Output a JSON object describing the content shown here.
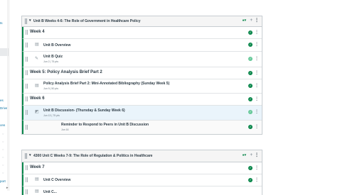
{
  "left_nav": {
    "items": [
      {
        "label": "ts",
        "icon": "person-icon"
      },
      {
        "label": "es",
        "icon": "outcomes-icon"
      },
      {
        "label": "Drive",
        "icon": "drive-icon"
      },
      {
        "label": "ons",
        "icon": "collaborations-icon"
      },
      {
        "label": "port",
        "icon": "support-icon"
      }
    ]
  },
  "modules": [
    {
      "title": "Unit B Weeks 4-6: The Role of Government in Healthcare Policy",
      "rows": [
        {
          "type": "header",
          "title": "Week 4"
        },
        {
          "type": "page",
          "icon": "page-icon",
          "title": "Unit B Overview"
        },
        {
          "type": "quiz",
          "icon": "quiz-icon",
          "title": "Unit B Quiz",
          "meta": "Jun 2  |  75 pts"
        },
        {
          "type": "header",
          "title": "Week 5: Policy Analysis Brief Part 2"
        },
        {
          "type": "assignment",
          "icon": "assignment-icon",
          "title": "Policy Analysis Brief Part 2: Mini-Annotated Bibliography (Sunday Week 5)",
          "meta": "Jun 9  |  50 pts"
        },
        {
          "type": "header",
          "title": "Week 6"
        },
        {
          "type": "discussion",
          "icon": "discussion-icon",
          "title": "Unit B Discussion- (Thursday & Sunday Week 6)",
          "meta": "Jun 13  |  75 pts"
        },
        {
          "type": "sub",
          "title": "Reminder to Respond to Peers in Unit B Discussion",
          "meta": "Jun 16"
        }
      ]
    },
    {
      "title": "4300 Unit C Weeks 7-9: The Role of Regulation & Politics in Healthcare",
      "rows": [
        {
          "type": "header",
          "title": "Week 7"
        },
        {
          "type": "page",
          "icon": "page-icon",
          "title": "Unit C Overview"
        },
        {
          "type": "page",
          "icon": "page-icon",
          "title": "Unit C..."
        }
      ]
    }
  ],
  "colors": {
    "published": "#0b874b",
    "border": "#c7cdd1",
    "link": "#0770a3"
  }
}
